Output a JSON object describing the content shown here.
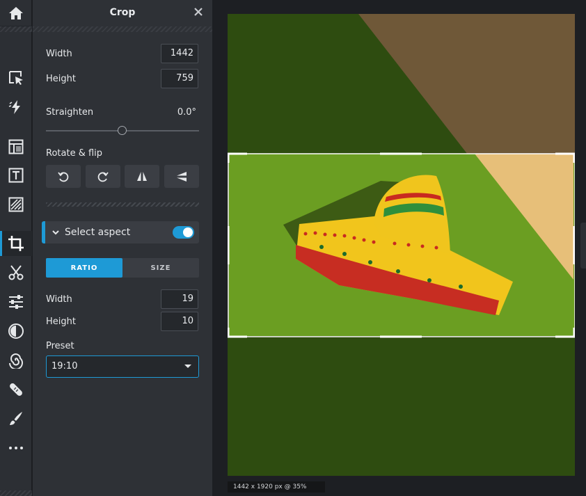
{
  "rail": {
    "tools": [
      {
        "name": "home-icon"
      },
      {
        "name": "select-icon"
      },
      {
        "name": "quick-action-icon"
      },
      {
        "name": "layout-icon"
      },
      {
        "name": "text-icon"
      },
      {
        "name": "texture-icon"
      },
      {
        "name": "crop-icon",
        "active": true
      },
      {
        "name": "cutout-icon"
      },
      {
        "name": "adjust-icon"
      },
      {
        "name": "contrast-icon"
      },
      {
        "name": "spiral-icon"
      },
      {
        "name": "heal-icon"
      },
      {
        "name": "brush-icon"
      },
      {
        "name": "more-icon"
      }
    ]
  },
  "panel": {
    "title": "Crop",
    "width_label": "Width",
    "width_value": "1442",
    "height_label": "Height",
    "height_value": "759",
    "straighten_label": "Straighten",
    "straighten_value": "0.0°",
    "straighten_fraction": 0.5,
    "rotate_flip_label": "Rotate & flip",
    "aspect": {
      "label": "Select aspect",
      "enabled": true
    },
    "tabs": {
      "ratio": "RATIO",
      "size": "SIZE",
      "active": "ratio"
    },
    "ratio_width_label": "Width",
    "ratio_width_value": "19",
    "ratio_height_label": "Height",
    "ratio_height_value": "10",
    "preset_label": "Preset",
    "preset_value": "19:10"
  },
  "canvas": {
    "status": "1442 x 1920 px @ 35%"
  },
  "colors": {
    "accent": "#1e9ad6",
    "panel_bg": "#2e3136",
    "rail_bg": "#2c2f34"
  }
}
